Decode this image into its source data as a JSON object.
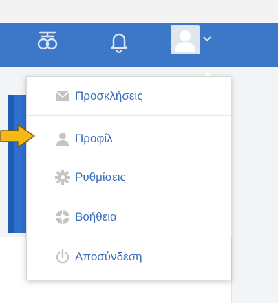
{
  "menu": {
    "items": [
      {
        "label": "Προσκλήσεις",
        "icon": "envelope-icon"
      },
      {
        "label": "Προφίλ",
        "icon": "user-icon"
      },
      {
        "label": "Ρυθμίσεις",
        "icon": "gear-icon"
      },
      {
        "label": "Βοήθεια",
        "icon": "help-lifebuoy-icon"
      },
      {
        "label": "Αποσύνδεση",
        "icon": "power-icon"
      }
    ]
  },
  "colors": {
    "topbar": "#3d78c8",
    "link": "#3b6fbd",
    "icon_gray": "#bfbfbf",
    "pointer_arrow": "#f6b817"
  }
}
